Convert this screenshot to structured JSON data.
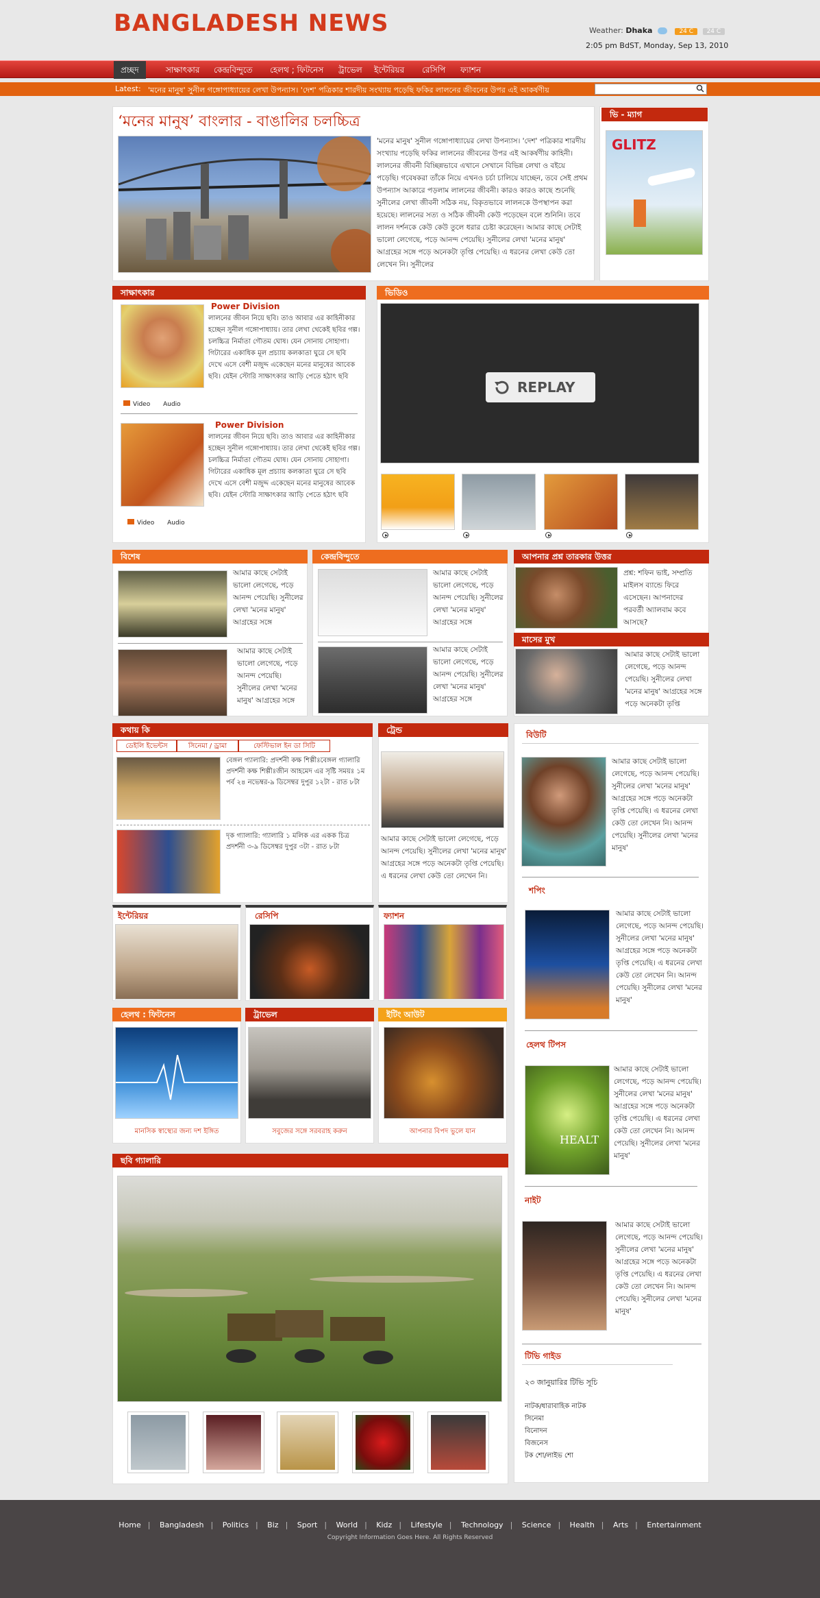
{
  "site": {
    "title": "BANGLADESH NEWS"
  },
  "weather": {
    "label": "Weather:",
    "city": "Dhaka",
    "temp_hi": "24 C",
    "temp_lo": "24 C",
    "datetime": "2:05 pm BdST, Monday, Sep 13, 2010"
  },
  "nav": [
    "প্রচ্ছদ",
    "সাক্ষাৎকার",
    "কেন্দ্রবিন্দুতে",
    "হেলথ ; ফিটনেস",
    "ট্রাভেল",
    "ইন্টেরিয়র",
    "রেসিপি",
    "ফ্যাশন"
  ],
  "ticker": {
    "label": "Latest:",
    "text": "'মনের মানুষ' সুনীল গঙ্গোপাধ্যায়ের লেখা উপন্যাস। 'দেশ' পত্রিকার শারদীয় সংখ্যায় পড়েছি ফকির লালনের জীবনের উপর এই আকর্ষণীয়"
  },
  "lead": {
    "title": "‘মনের মানুষ’ বাংলার - বাঙালির চলচ্চিত্র",
    "text": "'মনের মানুষ' সুনীল গঙ্গোপাধ্যায়ের লেখা উপন্যাস। 'দেশ' পত্রিকার শারদীয় সংখ্যায় পড়েছি ফকির লালনের জীবনের উপর এই আকর্ষণীয় কাহিনী। লালনের জীবনী বিচ্ছিন্নভাবে এখানে সেখানে বিভিন্ন লেখা ও বইয়ে পড়েছি। গবেষকরা তাঁকে নিয়ে এখনও চর্চা চালিয়ে যাচ্ছেন, তবে সেই প্রথম উপন্যাস আকারে পড়লাম লালনের জীবনী। কারও কারও কাছে শুনেছি সুনীলের লেখা জীবনী সঠিক নয়, বিকৃতভাবে লালনকে উপস্থাপন করা হয়েছে। লালনের সত্য ও সঠিক জীবনী কেউ পড়েছেন বলে শুনিনি। তবে লালন দর্শনকে কেউ কেউ তুলে ধরার চেষ্টা করেছেন। আমার কাছে সেটাই ভালো লেগেছে, পড়ে আনন্দ পেয়েছি। সুনীলের লেখা 'মনের মানুষ' আগ্রহের সঙ্গে পড়ে অনেকটা তৃপ্তি পেয়েছি। এ ধরনের লেখা কেউ তো লেখেন নি। সুনীলের"
  },
  "mag": {
    "header": "ভি - ম্যাগ",
    "cover_title": "GLITZ"
  },
  "interview": {
    "header": "সাক্ষাৎকার",
    "items": [
      {
        "title": "Power Division",
        "text": "লালনের জীবন নিয়ে ছবি। তাও আবার এর কাহিনীকার হচ্ছেন সুনীল গঙ্গোপাধ্যায়। তার লেখা থেকেই ছবির গল্প। চলচ্চিত্র নির্মাতা গৌতম ঘোষ। যেন সোনায় সোহাগা। গিটারের একাধিক মূল প্রচ্যায় কলকাতা ঘুরে সে ছবি দেখে এসে বেশী মজুদ্দ একেছেন মনের মানুষের আবেক ছবি। যেইন স্টোরি সাক্ষাৎকার আড়ি পেতে হঠাৎ ছবি",
        "video": "Video",
        "audio": "Audio"
      },
      {
        "title": "Power Division",
        "text": "লালনের জীবন নিয়ে ছবি। তাও আবার এর কাহিনীকার হচ্ছেন সুনীল গঙ্গোপাধ্যায়। তার লেখা থেকেই ছবির গল্প। চলচ্চিত্র নির্মাতা গৌতম ঘোষ। যেন সোনায় সোহাগা। গিটারের একাধিক মূল প্রচ্যায় কলকাতা ঘুরে সে ছবি দেখে এসে বেশী মজুদ্দ একেছেন মনের মানুষের আবেক ছবি। যেইন স্টোরি সাক্ষাৎকার আড়ি পেতে হঠাৎ ছবি",
        "video": "Video",
        "audio": "Audio"
      }
    ]
  },
  "video": {
    "header": "ভিডিও",
    "replay": "REPLAY"
  },
  "special": {
    "header": "বিশেষ",
    "text": "আমার কাছে সেটাই ভালো লেগেছে, পড়ে আনন্দ পেয়েছি। সুনীলের লেখা 'মনের মানুষ' আগ্রহের সঙ্গে"
  },
  "focus": {
    "header": "কেন্দ্রবিন্দুতে",
    "text": "আমার কাছে সেটাই ভালো লেগেছে, পড়ে আনন্দ পেয়েছি। সুনীলের লেখা 'মনের মানুষ' আগ্রহের সঙ্গে"
  },
  "qa": {
    "header": "আপনার প্রশ্ন তারকার উত্তর",
    "text": "প্রশ্ন: শফিন ভাই, সম্প্রতি মাইলস ব্যান্ডে ফিরে এসেছেন। আপনাদের পরবর্তী অ্যালবাম কবে আসছে?"
  },
  "face": {
    "header": "মাসের মুখ",
    "text": "আমার কাছে সেটাই ভালো লেগেছে, পড়ে আনন্দ পেয়েছি। সুনীলের লেখা 'মনের মানুষ' আগ্রহের সঙ্গে পড়ে অনেকটা তৃপ্তি"
  },
  "where": {
    "header": "কথায় কি",
    "tabs": [
      "ডেইলি ইভেন্টস",
      "সিনেমা / ড্রামা",
      "ফেস্টিভাল ইন ডা সিটি"
    ],
    "items": [
      "বেঙ্গল গ্যালারি: প্রদর্শনী কক্ষ শিল্পীঃবেঙ্গল গ্যালারি প্রদর্শনী কক্ষ শিল্পীঃজীন আহমেদ এর সৃষ্টি সময়ঃ ১ম পর্ব ২৪ নভেম্বর-৯ ডিসেম্বর দুপুর ১২টা - রাত ৮টা",
      "দৃক গ্যালারি: গ্যালারি ১ মলিক এর একক চিত্র প্রদর্শনী ৩-৯ ডিসেম্বর দুপুর ৩টা - রাত ৮টা"
    ]
  },
  "trend": {
    "header": "ট্রেন্ড",
    "text": "আমার কাছে সেটাই ভালো লেগেছে, পড়ে আনন্দ পেয়েছি। সুনীলের লেখা 'মনের মানুষ' আগ্রহের সঙ্গে পড়ে অনেকটা তৃপ্তি পেয়েছি। এ ধরনের লেখা কেউ তো লেখেন নি।"
  },
  "beauty": {
    "header": "বিউটি",
    "text": "আমার কাছে সেটাই ভালো লেগেছে, পড়ে আনন্দ পেয়েছি। সুনীলের লেখা 'মনের মানুষ' আগ্রহের সঙ্গে পড়ে অনেকটা তৃপ্তি পেয়েছি। এ ধরনের লেখা কেউ তো লেখেন নি। আনন্দ পেয়েছি। সুনীলের লেখা 'মনের মানুষ'"
  },
  "shopping": {
    "header": "শপিং",
    "text": "আমার কাছে সেটাই ভালো লেগেছে, পড়ে আনন্দ পেয়েছি। সুনীলের লেখা 'মনের মানুষ' আগ্রহের সঙ্গে পড়ে অনেকটা তৃপ্তি পেয়েছি। এ ধরনের লেখা কেউ তো লেখেন নি। আনন্দ পেয়েছি। সুনীলের লেখা 'মনের মানুষ'"
  },
  "health_tips": {
    "header": "হেলথ টিপস",
    "text": "আমার কাছে সেটাই ভালো লেগেছে, পড়ে আনন্দ পেয়েছি। সুনীলের লেখা 'মনের মানুষ' আগ্রহের সঙ্গে পড়ে অনেকটা তৃপ্তি পেয়েছি। এ ধরনের লেখা কেউ তো লেখেন নি। আনন্দ পেয়েছি। সুনীলের লেখা 'মনের মানুষ'",
    "img_text": "HEALT"
  },
  "night": {
    "header": "নাইট",
    "text": "আমার কাছে সেটাই ভালো লেগেছে, পড়ে আনন্দ পেয়েছি। সুনীলের লেখা 'মনের মানুষ' আগ্রহের সঙ্গে পড়ে অনেকটা তৃপ্তি পেয়েছি। এ ধরনের লেখা কেউ তো লেখেন নি। আনন্দ পেয়েছি। সুনীলের লেখা 'মনের মানুষ'"
  },
  "tv": {
    "header": "টিভি গাইড",
    "subtitle": "২৩ জানুয়ারির টিভি সূচি",
    "items": [
      "নাটক/ধারাবাহিক নাটক",
      "সিনেমা",
      "বিনোদন",
      "বিজনেস",
      "টক শো/লাইভ শো"
    ]
  },
  "interior": {
    "header": "ইন্টেরিয়র"
  },
  "recipe": {
    "header": "রেসিপি"
  },
  "fashion": {
    "header": "ফ্যাশন"
  },
  "health": {
    "header": "হেলথ : ফিটনেস",
    "caption": "মানসিক স্বাস্থ্যের জন্য দশ ইঙ্গিত"
  },
  "travel": {
    "header": "ট্রাভেল",
    "caption": "সবুজের সঙ্গে সরবরাহ করুন"
  },
  "eating": {
    "header": "ইটিং আউট",
    "caption": "আপনার বিপদ ভুলে যান"
  },
  "gallery": {
    "header": "ছবি গ্যালারি"
  },
  "footer": {
    "links": [
      "Home",
      "Bangladesh",
      "Politics",
      "Biz",
      "Sport",
      "World",
      "Kidz",
      "Lifestyle",
      "Technology",
      "Science",
      "Health",
      "Arts",
      "Entertainment"
    ],
    "copyright": "Copyright Information Goes Here. All Rights Reserved"
  },
  "colors": {
    "brand_red": "#c3290e",
    "orange": "#ee6d1f",
    "amber": "#f4a21a",
    "footer": "#4a4546"
  }
}
